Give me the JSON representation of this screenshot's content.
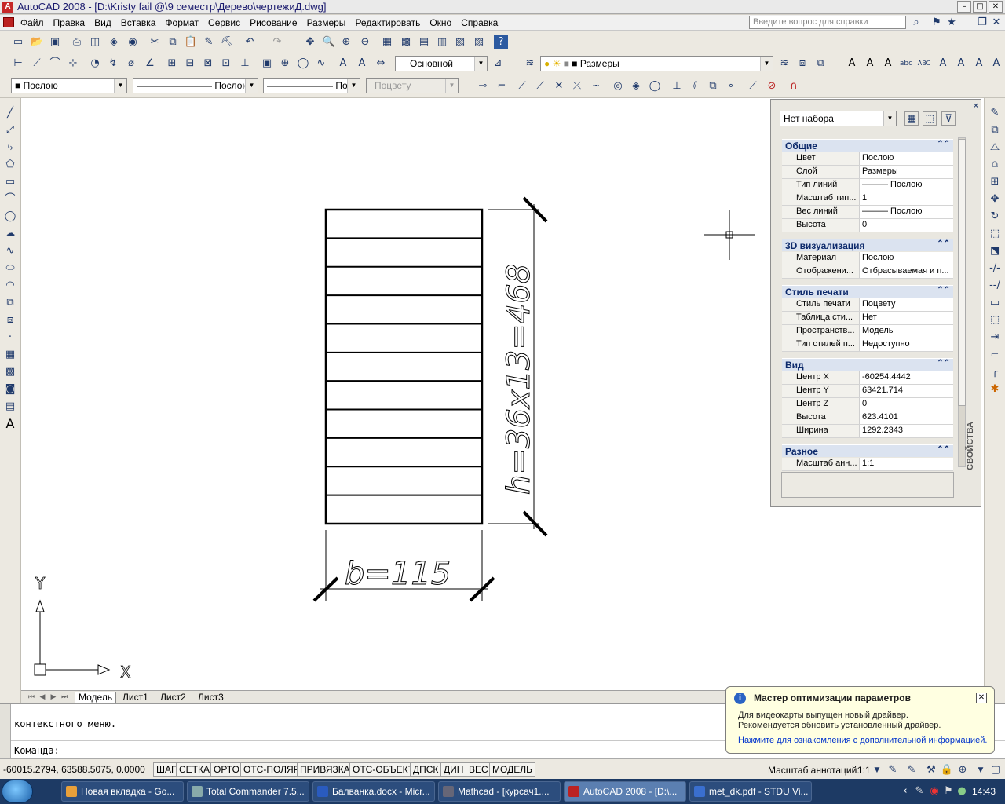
{
  "window": {
    "title": "AutoCAD 2008 - [D:\\Kristy fail @\\9 семестр\\Дерево\\чертежиД.dwg]"
  },
  "menu": {
    "items": [
      "Файл",
      "Правка",
      "Вид",
      "Вставка",
      "Формат",
      "Сервис",
      "Рисование",
      "Размеры",
      "Редактировать",
      "Окно",
      "Справка"
    ],
    "help_placeholder": "Введите вопрос для справки"
  },
  "toolbar": {
    "dim_style": "Основной",
    "layer": "Размеры",
    "color": "Послою",
    "linetype": "Послою",
    "lineweight": "Послою",
    "plotstyle": "Поцвету"
  },
  "drawing": {
    "dim_height": "h=36x13=468",
    "dim_width": "b=115",
    "ucs_x": "X",
    "ucs_y": "Y"
  },
  "tabs": [
    "Модель",
    "Лист1",
    "Лист2",
    "Лист3"
  ],
  "properties": {
    "selection": "Нет набора",
    "side_label": "СВОЙСТВА",
    "sections": [
      {
        "title": "Общие",
        "rows": [
          [
            "Цвет",
            "Послою"
          ],
          [
            "Слой",
            "Размеры"
          ],
          [
            "Тип линий",
            "——— Послою"
          ],
          [
            "Масштаб тип...",
            "1"
          ],
          [
            "Вес линий",
            "——— Послою"
          ],
          [
            "Высота",
            "0"
          ]
        ]
      },
      {
        "title": "3D визуализация",
        "rows": [
          [
            "Материал",
            "Послою"
          ],
          [
            "Отображени...",
            "Отбрасываемая и п..."
          ]
        ]
      },
      {
        "title": "Стиль печати",
        "rows": [
          [
            "Стиль печати",
            "Поцвету"
          ],
          [
            "Таблица сти...",
            "Нет"
          ],
          [
            "Пространств...",
            "Модель"
          ],
          [
            "Тип стилей п...",
            "Недоступно"
          ]
        ]
      },
      {
        "title": "Вид",
        "rows": [
          [
            "Центр X",
            "-60254.4442"
          ],
          [
            "Центр Y",
            "63421.714"
          ],
          [
            "Центр Z",
            "0"
          ],
          [
            "Высота",
            "623.4101"
          ],
          [
            "Ширина",
            "1292.2343"
          ]
        ]
      },
      {
        "title": "Разное",
        "rows": [
          [
            "Масштаб анн...",
            "1:1"
          ]
        ]
      }
    ]
  },
  "command": {
    "line1": "контекстного меню.",
    "line2": "Команда:"
  },
  "status": {
    "coords": "-60015.2794, 63588.5075, 0.0000",
    "buttons": [
      "ШАГ",
      "СЕТКА",
      "ОРТО",
      "ОТС-ПОЛЯР",
      "ПРИВЯЗКА",
      "ОТС-ОБЪЕКТ",
      "ДПСК",
      "ДИН",
      "ВЕС",
      "МОДЕЛЬ"
    ],
    "annot": "Масштаб аннотаций:",
    "annot_value": "1:1"
  },
  "popup": {
    "title": "Мастер оптимизации параметров",
    "line1": "Для видеокарты выпущен новый драйвер.",
    "line2": "Рекомендуется обновить установленный драйвер.",
    "link": "Нажмите для ознакомления с дополнительной информацией."
  },
  "taskbar": {
    "tasks": [
      "Новая вкладка - Go...",
      "Total Commander 7.5...",
      "Балванка.docx - Micr...",
      "Mathcad - [курсач1....",
      "AutoCAD 2008 - [D:\\...",
      "met_dk.pdf - STDU Vi..."
    ],
    "clock": "14:43"
  },
  "colors": {
    "title_text": "#1a1a6e",
    "category_bg": "#dbe3f0",
    "taskbar": "#1d3a64"
  }
}
